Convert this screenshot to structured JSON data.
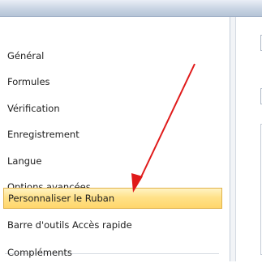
{
  "options_nav": {
    "items": [
      {
        "label": "Général"
      },
      {
        "label": "Formules"
      },
      {
        "label": "Vérification"
      },
      {
        "label": "Enregistrement"
      },
      {
        "label": "Langue"
      },
      {
        "label": "Options avancées"
      },
      {
        "label": "Personnaliser le Ruban",
        "selected": true
      },
      {
        "label": "Barre d'outils Accès rapide"
      },
      {
        "label": "Compléments"
      }
    ]
  },
  "content_fragments": {
    "top_letter": "C",
    "mid_letter": "C"
  },
  "annotation": {
    "arrow_color": "#e01a1a"
  }
}
